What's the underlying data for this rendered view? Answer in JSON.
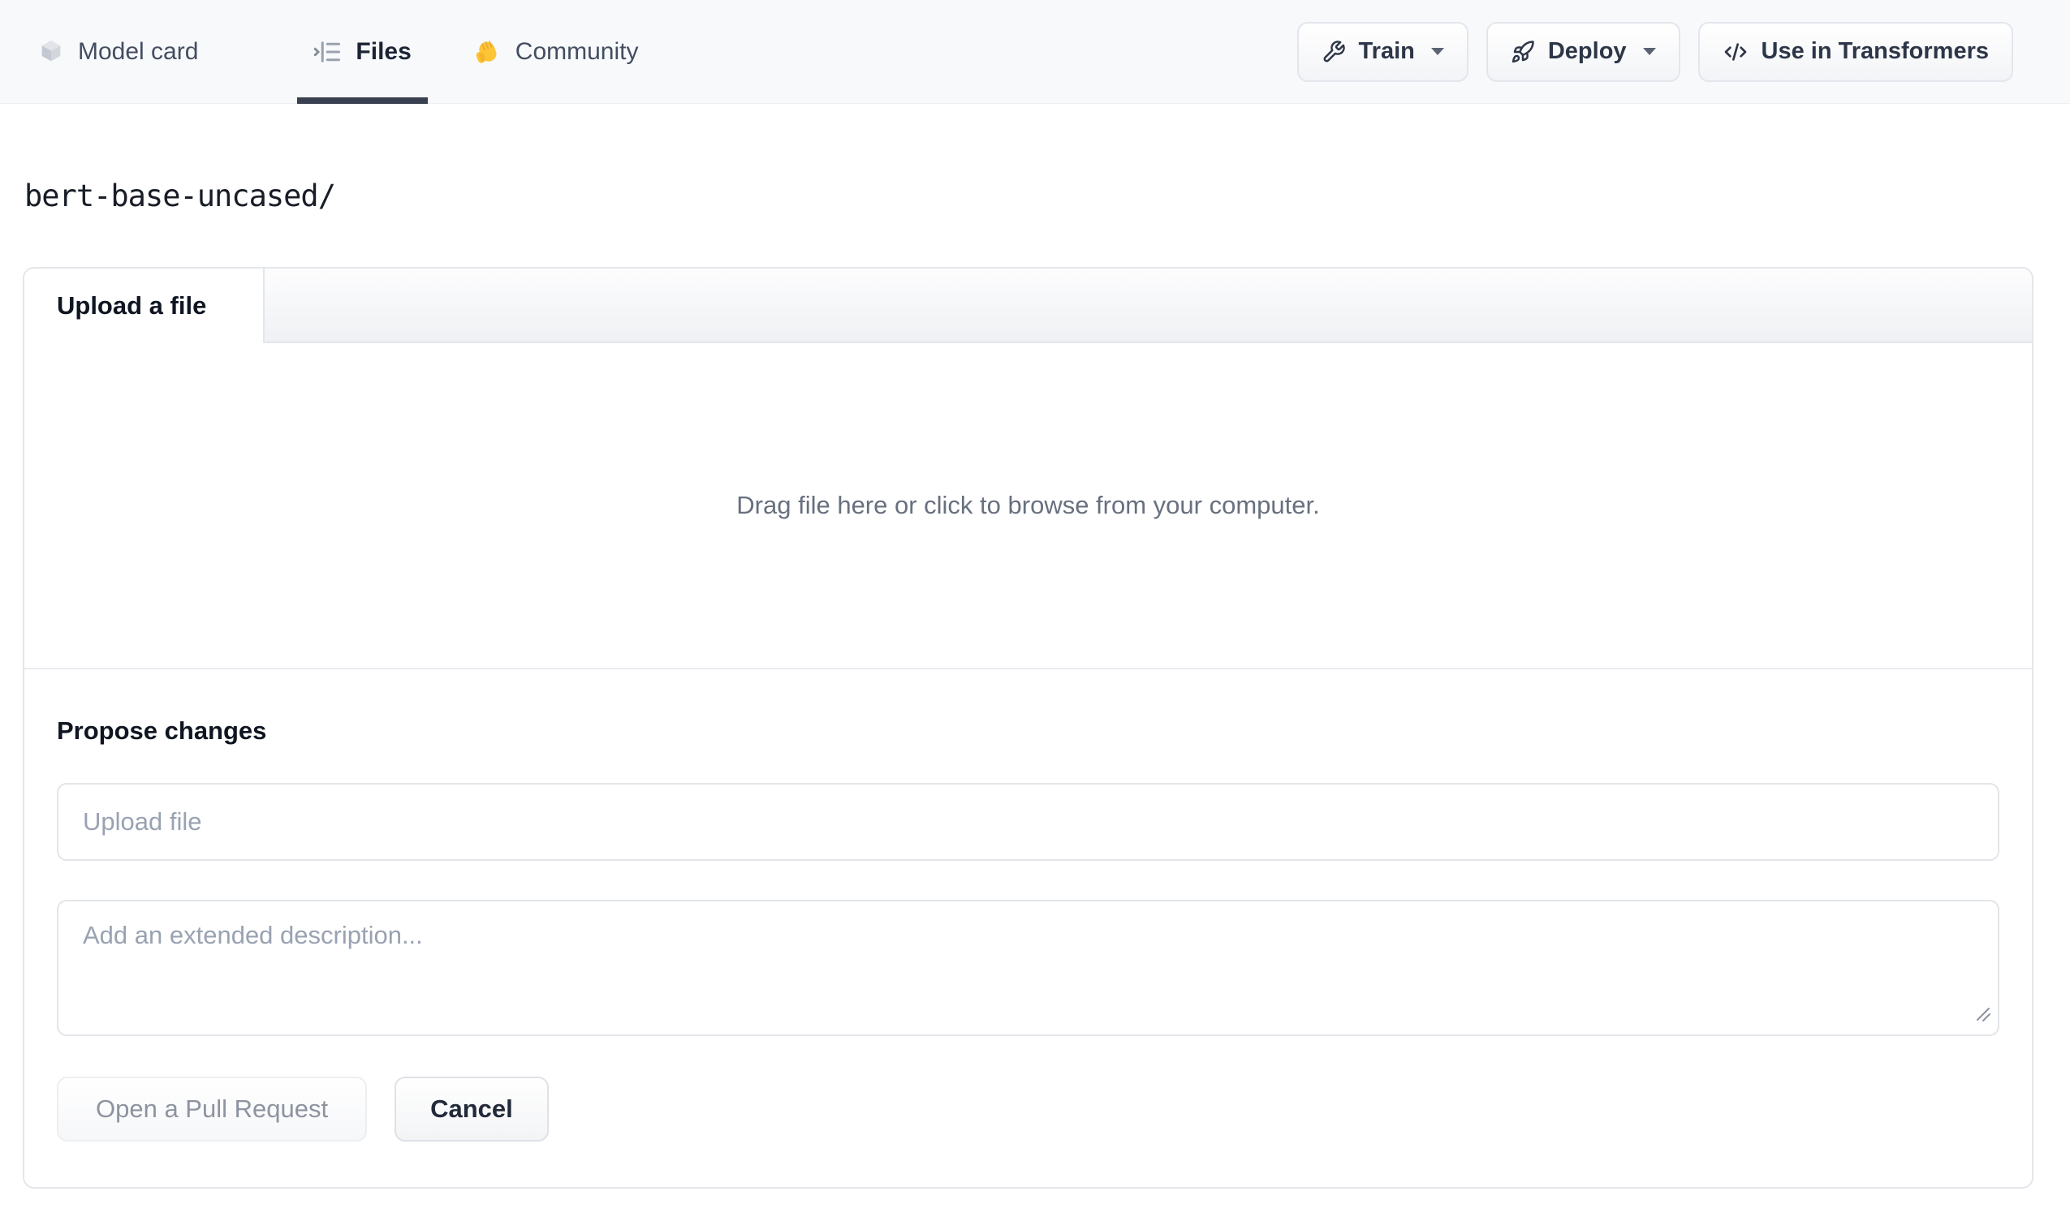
{
  "header": {
    "tabs": [
      {
        "label": "Model card",
        "icon": "cube-icon",
        "active": false
      },
      {
        "label": "Files",
        "icon": "files-list-icon",
        "active": true
      },
      {
        "label": "Community",
        "icon": "waving-hand-icon",
        "active": false
      }
    ],
    "actions": {
      "train": {
        "label": "Train",
        "icon": "wrench-icon",
        "has_dropdown": true
      },
      "deploy": {
        "label": "Deploy",
        "icon": "rocket-icon",
        "has_dropdown": true
      },
      "use_in_transformers": {
        "label": "Use in Transformers",
        "icon": "code-icon",
        "has_dropdown": false
      }
    }
  },
  "breadcrumb": {
    "path": "bert-base-uncased/"
  },
  "upload_panel": {
    "tab_label": "Upload a file",
    "dropzone_text": "Drag file here or click to browse from your computer.",
    "propose": {
      "heading": "Propose changes",
      "file_input_placeholder": "Upload file",
      "description_placeholder": "Add an extended description...",
      "submit_label": "Open a Pull Request",
      "cancel_label": "Cancel"
    }
  },
  "colors": {
    "nav_background": "#f8f9fb",
    "active_tab_underline": "#394150",
    "panel_border": "#e3e6ea",
    "dropzone_text": "#68707f",
    "placeholder_text": "#99a2b2",
    "disabled_button_text": "#8d939f",
    "hand_emoji_yellow": "#fdc535"
  }
}
